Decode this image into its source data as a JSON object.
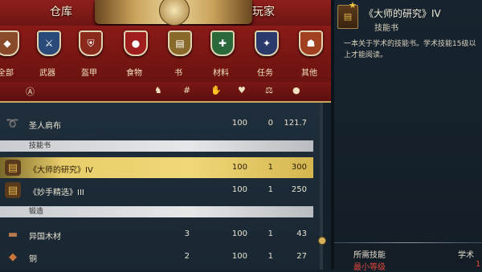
{
  "tabs": {
    "store": "仓库",
    "player": "玩家"
  },
  "categories": [
    {
      "label": "全部",
      "icon": "all-icon",
      "color": "#8a4a2a"
    },
    {
      "label": "武器",
      "icon": "sword-icon",
      "color": "#2a4a7a"
    },
    {
      "label": "盔甲",
      "icon": "armor-icon",
      "color": "#8a2a1c"
    },
    {
      "label": "食物",
      "icon": "apple-icon",
      "color": "#a01e1e"
    },
    {
      "label": "书",
      "icon": "book-icon",
      "color": "#8a6a2a"
    },
    {
      "label": "材料",
      "icon": "material-icon",
      "color": "#2a6a3a"
    },
    {
      "label": "任务",
      "icon": "quest-icon",
      "color": "#2a3a6a"
    },
    {
      "label": "其他",
      "icon": "other-icon",
      "color": "#a04020"
    }
  ],
  "sort_icons": [
    "sort-az-icon",
    "armor-sort-icon",
    "hash-icon",
    "weight-icon",
    "condition-icon",
    "weight-kg-icon",
    "coins-icon"
  ],
  "list": {
    "partial_header": "",
    "rows_top": [
      {
        "name": "圣人肩布",
        "qty": "",
        "cond": "100",
        "w": "0",
        "price": "121.7",
        "icon": "cloth-icon"
      }
    ],
    "group_books": "技能书",
    "rows_books": [
      {
        "name": "《大师的研究》IV",
        "qty": "",
        "cond": "100",
        "w": "1",
        "price": "300",
        "icon": "book-icon",
        "selected": true
      },
      {
        "name": "《妙手精选》III",
        "qty": "",
        "cond": "100",
        "w": "1",
        "price": "250",
        "icon": "book-icon"
      }
    ],
    "group_smith": "锻造",
    "rows_smith": [
      {
        "name": "异国木材",
        "qty": "3",
        "cond": "100",
        "w": "1",
        "price": "43",
        "icon": "wood-icon"
      },
      {
        "name": "铜",
        "qty": "2",
        "cond": "100",
        "w": "1",
        "price": "27",
        "icon": "ore-icon"
      }
    ]
  },
  "detail": {
    "title": "《大师的研究》IV",
    "type": "技能书",
    "desc_line1": "一本关于学术的技能书。学术技能15级以",
    "desc_line2": "上才能阅读。",
    "req_label": "所需技能",
    "req_label2": "学术",
    "min_label": "最小等级",
    "min_value": "1"
  },
  "colors": {
    "accent": "#e8cd6a",
    "header_red": "#8a1a17",
    "warning": "#e0463c"
  }
}
